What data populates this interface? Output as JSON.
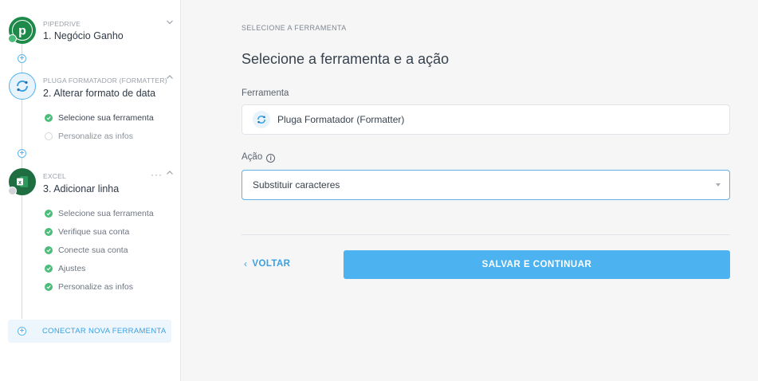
{
  "sidebar": {
    "steps": [
      {
        "app": "PIPEDRIVE",
        "title": "1. Negócio Ganho",
        "icon": "pipedrive-logo"
      },
      {
        "app": "PLUGA FORMATADOR (FORMATTER)",
        "title": "2. Alterar formato de data",
        "icon": "pluga-formatter-logo",
        "substeps": [
          {
            "label": "Selecione sua ferramenta",
            "status": "done"
          },
          {
            "label": "Personalize as infos",
            "status": "pending"
          }
        ]
      },
      {
        "app": "EXCEL",
        "title": "3. Adicionar linha",
        "icon": "excel-logo",
        "menu": "···",
        "substeps": [
          {
            "label": "Selecione sua ferramenta",
            "status": "done"
          },
          {
            "label": "Verifique sua conta",
            "status": "done"
          },
          {
            "label": "Conecte sua conta",
            "status": "done"
          },
          {
            "label": "Ajustes",
            "status": "done"
          },
          {
            "label": "Personalize as infos",
            "status": "done"
          }
        ]
      }
    ],
    "connect_label": "CONECTAR NOVA FERRAMENTA"
  },
  "main": {
    "breadcrumb": "SELECIONE A FERRAMENTA",
    "heading": "Selecione a ferramenta e a ação",
    "tool_label": "Ferramenta",
    "tool_value": "Pluga Formatador (Formatter)",
    "action_label": "Ação",
    "action_value": "Substituir caracteres",
    "back_label": "VOLTAR",
    "save_label": "SALVAR E CONTINUAR"
  },
  "colors": {
    "accent": "#4db2f0",
    "success": "#4cbc7a",
    "pipedrive": "#1d8a4a",
    "excel": "#1e6e42"
  }
}
